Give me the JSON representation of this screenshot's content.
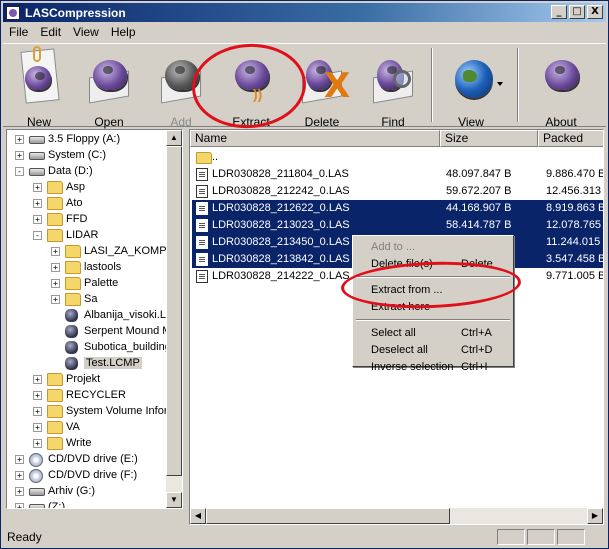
{
  "window": {
    "title": "LASCompression",
    "minimize": "_",
    "maximize": "□",
    "close": "X"
  },
  "menu": [
    "File",
    "Edit",
    "View",
    "Help"
  ],
  "toolbar": [
    {
      "label": "New",
      "icon": "new-icon",
      "enabled": true
    },
    {
      "label": "Open",
      "icon": "open-icon",
      "enabled": true
    },
    {
      "label": "Add",
      "icon": "add-icon",
      "enabled": false
    },
    {
      "label": "Extract",
      "icon": "extract-icon",
      "enabled": true
    },
    {
      "label": "Delete",
      "icon": "delete-icon",
      "enabled": true
    },
    {
      "label": "Find",
      "icon": "find-icon",
      "enabled": true
    },
    {
      "label": "View",
      "icon": "view-globe-icon",
      "enabled": true
    },
    {
      "label": "About",
      "icon": "about-icon",
      "enabled": true
    }
  ],
  "tree": [
    {
      "label": "3.5 Floppy (A:)",
      "level": 0,
      "icon": "floppy",
      "expander": "+"
    },
    {
      "label": "System (C:)",
      "level": 0,
      "icon": "drive",
      "expander": "+"
    },
    {
      "label": "Data (D:)",
      "level": 0,
      "icon": "drive",
      "expander": "-"
    },
    {
      "label": "Asp",
      "level": 1,
      "icon": "folder",
      "expander": "+"
    },
    {
      "label": "Ato",
      "level": 1,
      "icon": "folder",
      "expander": "+"
    },
    {
      "label": "FFD",
      "level": 1,
      "icon": "folder",
      "expander": "+"
    },
    {
      "label": "LIDAR",
      "level": 1,
      "icon": "folder",
      "expander": "-"
    },
    {
      "label": "LASI_ZA_KOMPR",
      "level": 2,
      "icon": "folder",
      "expander": "+"
    },
    {
      "label": "lastools",
      "level": 2,
      "icon": "folder",
      "expander": "+"
    },
    {
      "label": "Palette",
      "level": 2,
      "icon": "folder",
      "expander": "+"
    },
    {
      "label": "Sa",
      "level": 2,
      "icon": "folder",
      "expander": "+"
    },
    {
      "label": "Albanija_visoki.L",
      "level": 2,
      "icon": "lcmp",
      "expander": ""
    },
    {
      "label": "Serpent Mound M",
      "level": 2,
      "icon": "lcmp",
      "expander": ""
    },
    {
      "label": "Subotica_building",
      "level": 2,
      "icon": "lcmp",
      "expander": ""
    },
    {
      "label": "Test.LCMP",
      "level": 2,
      "icon": "lcmp",
      "expander": "",
      "selected": true
    },
    {
      "label": "Projekt",
      "level": 1,
      "icon": "folder",
      "expander": "+"
    },
    {
      "label": "RECYCLER",
      "level": 1,
      "icon": "folder",
      "expander": "+"
    },
    {
      "label": "System Volume Infor",
      "level": 1,
      "icon": "folder",
      "expander": "+"
    },
    {
      "label": "VA",
      "level": 1,
      "icon": "folder",
      "expander": "+"
    },
    {
      "label": "Write",
      "level": 1,
      "icon": "folder",
      "expander": "+"
    },
    {
      "label": "CD/DVD drive (E:)",
      "level": 0,
      "icon": "cd",
      "expander": "+"
    },
    {
      "label": "CD/DVD drive (F:)",
      "level": 0,
      "icon": "cd",
      "expander": "+"
    },
    {
      "label": "Arhiv (G:)",
      "level": 0,
      "icon": "drive",
      "expander": "+"
    },
    {
      "label": "(Z:)",
      "level": 0,
      "icon": "drive",
      "expander": "+"
    }
  ],
  "list": {
    "columns": {
      "name": "Name",
      "size": "Size",
      "packed": "Packed"
    },
    "rows": [
      {
        "name": "..",
        "size": "",
        "packed": "",
        "folder": true,
        "selected": false
      },
      {
        "name": "LDR030828_211804_0.LAS",
        "size": "48.097.847 B",
        "packed": "9.886.470 B",
        "selected": false
      },
      {
        "name": "LDR030828_212242_0.LAS",
        "size": "59.672.207 B",
        "packed": "12.456.313",
        "selected": false
      },
      {
        "name": "LDR030828_212622_0.LAS",
        "size": "44.168.907 B",
        "packed": "8.919.863 B",
        "selected": true
      },
      {
        "name": "LDR030828_213023_0.LAS",
        "size": "58.414.787 B",
        "packed": "12.078.765",
        "selected": true
      },
      {
        "name": "LDR030828_213450_0.LAS",
        "size": "",
        "packed": "11.244.015",
        "selected": true
      },
      {
        "name": "LDR030828_213842_0.LAS",
        "size": "",
        "packed": "3.547.458 B",
        "selected": true
      },
      {
        "name": "LDR030828_214222_0.LAS",
        "size": "",
        "packed": "9.771.005 B",
        "selected": false
      }
    ]
  },
  "context_menu": [
    {
      "label": "Add to ...",
      "shortcut": "",
      "enabled": false
    },
    {
      "label": "Delete file(s)",
      "shortcut": "Delete",
      "enabled": true
    },
    {
      "sep": true
    },
    {
      "label": "Extract from ...",
      "shortcut": "",
      "enabled": true
    },
    {
      "label": "Extract here",
      "shortcut": "",
      "enabled": true
    },
    {
      "sep": true
    },
    {
      "label": "Select all",
      "shortcut": "Ctrl+A",
      "enabled": true
    },
    {
      "label": "Deselect all",
      "shortcut": "Ctrl+D",
      "enabled": true
    },
    {
      "label": "Inverse selection",
      "shortcut": "Ctrl+I",
      "enabled": true
    }
  ],
  "status": {
    "text": "Ready"
  },
  "highlight_color": "#e0101a",
  "selection_color": "#0a246a"
}
